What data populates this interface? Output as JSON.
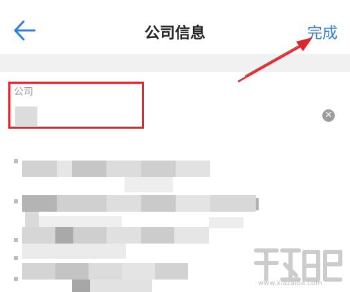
{
  "nav": {
    "back_icon": "arrow-left-icon",
    "title": "公司信息",
    "done_label": "完成"
  },
  "form": {
    "company_label": "公司",
    "company_value": "",
    "clear_icon": "clear-circle-icon"
  },
  "annotation": {
    "highlight_color": "#e0242c",
    "arrow_color": "#e0242c"
  },
  "watermark": {
    "url": "www.xiazaiba.com"
  },
  "colors": {
    "accent": "#2f7fd8"
  }
}
